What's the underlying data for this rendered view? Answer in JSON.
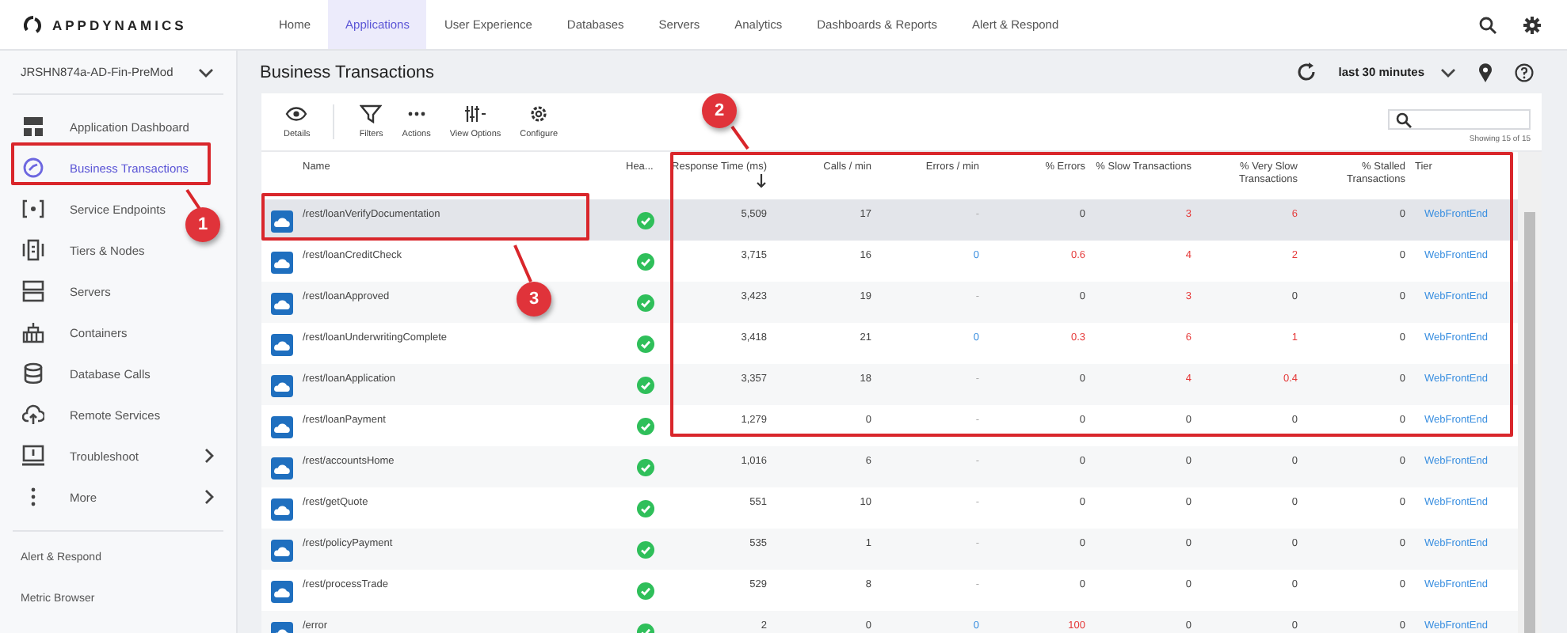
{
  "brand": "APPDYNAMICS",
  "nav": [
    {
      "label": "Home",
      "selected": false
    },
    {
      "label": "Applications",
      "selected": true
    },
    {
      "label": "User Experience",
      "selected": false
    },
    {
      "label": "Databases",
      "selected": false
    },
    {
      "label": "Servers",
      "selected": false
    },
    {
      "label": "Analytics",
      "selected": false
    },
    {
      "label": "Dashboards & Reports",
      "selected": false
    },
    {
      "label": "Alert & Respond",
      "selected": false
    }
  ],
  "sidebar": {
    "app_selector": "JRSHN874a-AD-Fin-PreMod",
    "items": [
      {
        "label": "Application Dashboard",
        "selected": false,
        "submenu": false
      },
      {
        "label": "Business Transactions",
        "selected": true,
        "submenu": false
      },
      {
        "label": "Service Endpoints",
        "selected": false,
        "submenu": false
      },
      {
        "label": "Tiers & Nodes",
        "selected": false,
        "submenu": false
      },
      {
        "label": "Servers",
        "selected": false,
        "submenu": false
      },
      {
        "label": "Containers",
        "selected": false,
        "submenu": false
      },
      {
        "label": "Database Calls",
        "selected": false,
        "submenu": false
      },
      {
        "label": "Remote Services",
        "selected": false,
        "submenu": false
      },
      {
        "label": "Troubleshoot",
        "selected": false,
        "submenu": true
      },
      {
        "label": "More",
        "selected": false,
        "submenu": true
      }
    ],
    "links": [
      "Alert & Respond",
      "Metric Browser"
    ]
  },
  "page_title": "Business Transactions",
  "time_range": "last 30 minutes",
  "toolbar": [
    "Details",
    "Filters",
    "Actions",
    "View Options",
    "Configure"
  ],
  "showing": "Showing 15 of 15",
  "table": {
    "columns": [
      {
        "label": "Name",
        "sorted": false
      },
      {
        "label": "Hea...",
        "sorted": false
      },
      {
        "label": "Response Time (ms)",
        "sorted": true
      },
      {
        "label": "Calls / min",
        "sorted": false
      },
      {
        "label": "Errors / min",
        "sorted": false
      },
      {
        "label": "% Errors",
        "sorted": false
      },
      {
        "label": "% Slow Transactions",
        "sorted": false
      },
      {
        "label": "% Very Slow Transactions",
        "sorted": false
      },
      {
        "label": "% Stalled Transactions",
        "sorted": false
      },
      {
        "label": "Tier",
        "sorted": false
      }
    ],
    "rows": [
      {
        "name": "/rest/loanVerifyDocumentation",
        "selected": true,
        "healthy": true,
        "metrics": [
          {
            "text": "5,509",
            "kind": "plain"
          },
          {
            "text": "17",
            "kind": "plain"
          },
          {
            "text": "-",
            "kind": "empty"
          },
          {
            "text": "0",
            "kind": "plain"
          },
          {
            "text": "3",
            "kind": "alert"
          },
          {
            "text": "6",
            "kind": "alert"
          },
          {
            "text": "0",
            "kind": "plain"
          }
        ],
        "tier": "WebFrontEnd"
      },
      {
        "name": "/rest/loanCreditCheck",
        "selected": false,
        "healthy": true,
        "metrics": [
          {
            "text": "3,715",
            "kind": "plain"
          },
          {
            "text": "16",
            "kind": "plain"
          },
          {
            "text": "0",
            "kind": "link"
          },
          {
            "text": "0.6",
            "kind": "alert"
          },
          {
            "text": "4",
            "kind": "alert"
          },
          {
            "text": "2",
            "kind": "alert"
          },
          {
            "text": "0",
            "kind": "plain"
          }
        ],
        "tier": "WebFrontEnd"
      },
      {
        "name": "/rest/loanApproved",
        "selected": false,
        "healthy": true,
        "metrics": [
          {
            "text": "3,423",
            "kind": "plain"
          },
          {
            "text": "19",
            "kind": "plain"
          },
          {
            "text": "-",
            "kind": "empty"
          },
          {
            "text": "0",
            "kind": "plain"
          },
          {
            "text": "3",
            "kind": "alert"
          },
          {
            "text": "0",
            "kind": "plain"
          },
          {
            "text": "0",
            "kind": "plain"
          }
        ],
        "tier": "WebFrontEnd"
      },
      {
        "name": "/rest/loanUnderwritingComplete",
        "selected": false,
        "healthy": true,
        "metrics": [
          {
            "text": "3,418",
            "kind": "plain"
          },
          {
            "text": "21",
            "kind": "plain"
          },
          {
            "text": "0",
            "kind": "link"
          },
          {
            "text": "0.3",
            "kind": "alert"
          },
          {
            "text": "6",
            "kind": "alert"
          },
          {
            "text": "1",
            "kind": "alert"
          },
          {
            "text": "0",
            "kind": "plain"
          }
        ],
        "tier": "WebFrontEnd"
      },
      {
        "name": "/rest/loanApplication",
        "selected": false,
        "healthy": true,
        "metrics": [
          {
            "text": "3,357",
            "kind": "plain"
          },
          {
            "text": "18",
            "kind": "plain"
          },
          {
            "text": "-",
            "kind": "empty"
          },
          {
            "text": "0",
            "kind": "plain"
          },
          {
            "text": "4",
            "kind": "alert"
          },
          {
            "text": "0.4",
            "kind": "alert"
          },
          {
            "text": "0",
            "kind": "plain"
          }
        ],
        "tier": "WebFrontEnd"
      },
      {
        "name": "/rest/loanPayment",
        "selected": false,
        "healthy": true,
        "metrics": [
          {
            "text": "1,279",
            "kind": "plain"
          },
          {
            "text": "0",
            "kind": "plain"
          },
          {
            "text": "-",
            "kind": "empty"
          },
          {
            "text": "0",
            "kind": "plain"
          },
          {
            "text": "0",
            "kind": "plain"
          },
          {
            "text": "0",
            "kind": "plain"
          },
          {
            "text": "0",
            "kind": "plain"
          }
        ],
        "tier": "WebFrontEnd"
      },
      {
        "name": "/rest/accountsHome",
        "selected": false,
        "healthy": true,
        "metrics": [
          {
            "text": "1,016",
            "kind": "plain"
          },
          {
            "text": "6",
            "kind": "plain"
          },
          {
            "text": "-",
            "kind": "empty"
          },
          {
            "text": "0",
            "kind": "plain"
          },
          {
            "text": "0",
            "kind": "plain"
          },
          {
            "text": "0",
            "kind": "plain"
          },
          {
            "text": "0",
            "kind": "plain"
          }
        ],
        "tier": "WebFrontEnd"
      },
      {
        "name": "/rest/getQuote",
        "selected": false,
        "healthy": true,
        "metrics": [
          {
            "text": "551",
            "kind": "plain"
          },
          {
            "text": "10",
            "kind": "plain"
          },
          {
            "text": "-",
            "kind": "empty"
          },
          {
            "text": "0",
            "kind": "plain"
          },
          {
            "text": "0",
            "kind": "plain"
          },
          {
            "text": "0",
            "kind": "plain"
          },
          {
            "text": "0",
            "kind": "plain"
          }
        ],
        "tier": "WebFrontEnd"
      },
      {
        "name": "/rest/policyPayment",
        "selected": false,
        "healthy": true,
        "metrics": [
          {
            "text": "535",
            "kind": "plain"
          },
          {
            "text": "1",
            "kind": "plain"
          },
          {
            "text": "-",
            "kind": "empty"
          },
          {
            "text": "0",
            "kind": "plain"
          },
          {
            "text": "0",
            "kind": "plain"
          },
          {
            "text": "0",
            "kind": "plain"
          },
          {
            "text": "0",
            "kind": "plain"
          }
        ],
        "tier": "WebFrontEnd"
      },
      {
        "name": "/rest/processTrade",
        "selected": false,
        "healthy": true,
        "metrics": [
          {
            "text": "529",
            "kind": "plain"
          },
          {
            "text": "8",
            "kind": "plain"
          },
          {
            "text": "-",
            "kind": "empty"
          },
          {
            "text": "0",
            "kind": "plain"
          },
          {
            "text": "0",
            "kind": "plain"
          },
          {
            "text": "0",
            "kind": "plain"
          },
          {
            "text": "0",
            "kind": "plain"
          }
        ],
        "tier": "WebFrontEnd"
      },
      {
        "name": "/error",
        "selected": false,
        "healthy": true,
        "metrics": [
          {
            "text": "2",
            "kind": "plain"
          },
          {
            "text": "0",
            "kind": "plain"
          },
          {
            "text": "0",
            "kind": "link"
          },
          {
            "text": "100",
            "kind": "alert"
          },
          {
            "text": "0",
            "kind": "plain"
          },
          {
            "text": "0",
            "kind": "plain"
          },
          {
            "text": "0",
            "kind": "plain"
          }
        ],
        "tier": "WebFrontEnd"
      }
    ]
  },
  "annotations": [
    {
      "label": "1"
    },
    {
      "label": "2"
    },
    {
      "label": "3"
    }
  ]
}
